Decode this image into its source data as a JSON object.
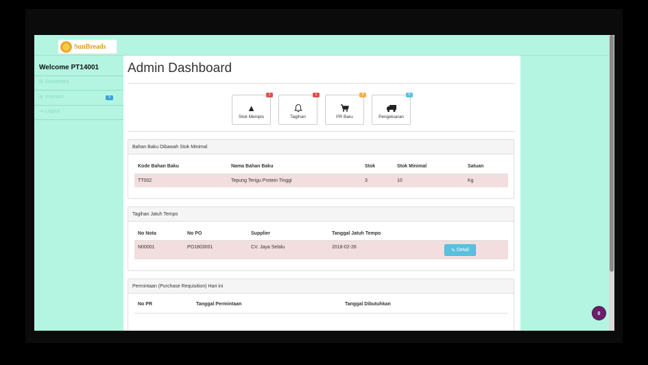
{
  "brand": {
    "name": "SunBreads"
  },
  "sidebar": {
    "welcome": "Welcome PT14001",
    "items": [
      {
        "label": "Dashboard",
        "icon": "dashboard-icon"
      },
      {
        "label": "Inventori",
        "icon": "dashboard-icon",
        "badge": "3"
      },
      {
        "label": "Logout",
        "icon": "logout-icon"
      }
    ]
  },
  "main": {
    "title": "Admin Dashboard",
    "tiles": [
      {
        "label": "Stok Menipis",
        "badge": "1",
        "badge_color": "#d9534f",
        "icon": "warning-icon"
      },
      {
        "label": "Tagihan",
        "badge": "1",
        "badge_color": "#d9534f",
        "icon": "bell-icon"
      },
      {
        "label": "PR Baru",
        "badge": "0",
        "badge_color": "#f0ad4e",
        "icon": "cart-icon"
      },
      {
        "label": "Pengeluaran",
        "badge": "0",
        "badge_color": "#5bc0de",
        "icon": "truck-icon"
      }
    ],
    "panels": {
      "stok": {
        "title": "Bahan Baku Dibawah Stok Minimal",
        "columns": [
          "Kode Bahan Baku",
          "Nama Bahan Baku",
          "Stok",
          "Stok Minimal",
          "Satuan"
        ],
        "rows": [
          [
            "TT002",
            "Tepung Terigu Protein Tinggi",
            "3",
            "10",
            "Kg"
          ]
        ]
      },
      "tagihan": {
        "title": "Tagihan Jatuh Tempo",
        "columns": [
          "No Nota",
          "No PO",
          "Supplier",
          "Tanggal Jatuh Tempo"
        ],
        "rows": [
          [
            "N00001",
            "PO1803001",
            "CV. Jaya Selalu",
            "2018-02-26"
          ]
        ],
        "detail_label": "Detail"
      },
      "pr": {
        "title": "Permintaan (Purchase Requisition) Hari ini",
        "columns": [
          "No PR",
          "Tanggal Permintaan",
          "Tanggal Dibutuhkan"
        ]
      }
    }
  },
  "chat": {
    "count": "0"
  },
  "colors": {
    "background": "#b3f5e1",
    "row_highlight": "#f2dede",
    "info": "#5bc0de",
    "danger": "#d9534f",
    "warning": "#f0ad4e"
  }
}
